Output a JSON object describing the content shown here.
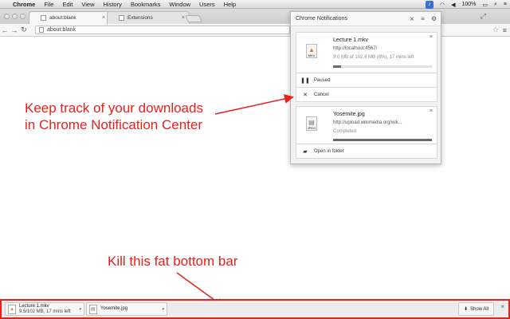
{
  "menubar": {
    "app": "Chrome",
    "items": [
      "File",
      "Edit",
      "View",
      "History",
      "Bookmarks",
      "Window",
      "Users",
      "Help"
    ],
    "battery": "100%"
  },
  "tabs": [
    {
      "label": "about:blank"
    },
    {
      "label": "Extensions"
    }
  ],
  "toolbar": {
    "url": "about:blank"
  },
  "notifications": {
    "header": "Chrome Notifications",
    "download1": {
      "filename": "Lecture 1.mkv",
      "url": "http://localhost:4567/",
      "status": "9.0 MB of 102.4 MB (8%), 17 mins left",
      "progress": 0.08,
      "icon_label": "MKV"
    },
    "paused_label": "Paused",
    "cancel_label": "Cancel",
    "download2": {
      "filename": "Yosemite.jpg",
      "url": "http://upload.wikimedia.org/wik...",
      "status": "Completed",
      "progress": 1.0,
      "icon_label": "JPEG"
    },
    "open_folder_label": "Open in folder"
  },
  "annotations": {
    "top_line1": "Keep track of your downloads",
    "top_line2": "in Chrome Notification Center",
    "bottom": "Kill this fat bottom bar"
  },
  "shelf": {
    "item1_name": "Lecture 1.mkv",
    "item1_status": "9.5/102 MB, 17 mins left",
    "item2_name": "Yosemite.jpg",
    "show_all": "Show All"
  },
  "colors": {
    "annotation_red": "#e8211c"
  }
}
